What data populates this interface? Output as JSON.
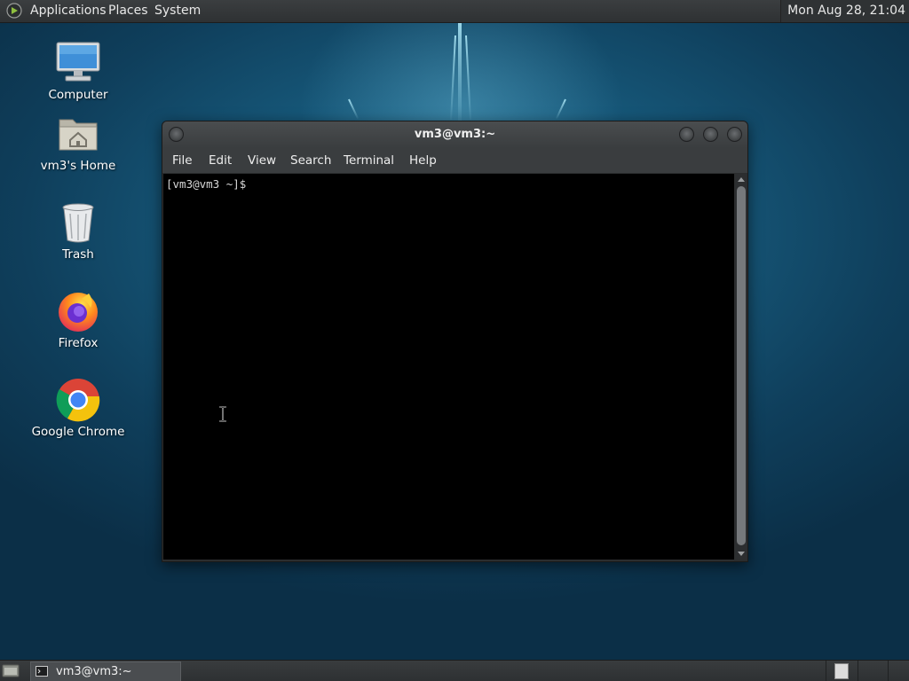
{
  "top_panel": {
    "menus": [
      "Applications",
      "Places",
      "System"
    ],
    "clock": "Mon Aug 28, 21:04"
  },
  "desktop_icons": [
    {
      "label": "Computer",
      "icon": "computer-icon"
    },
    {
      "label": "vm3's Home",
      "icon": "home-folder-icon"
    },
    {
      "label": "Trash",
      "icon": "trash-icon"
    },
    {
      "label": "Firefox",
      "icon": "firefox-icon"
    },
    {
      "label": "Google Chrome",
      "icon": "chrome-icon"
    }
  ],
  "terminal": {
    "title": "vm3@vm3:~",
    "menus": [
      "File",
      "Edit",
      "View",
      "Search",
      "Terminal",
      "Help"
    ],
    "prompt": "[vm3@vm3 ~]$"
  },
  "taskbar": {
    "items": [
      {
        "label": "vm3@vm3:~",
        "icon": "terminal-icon"
      }
    ]
  },
  "colors": {
    "panel": "#2e3133",
    "desktop": "#175a7c",
    "terminal_bg": "#000000",
    "terminal_text": "#d8d8d8"
  }
}
